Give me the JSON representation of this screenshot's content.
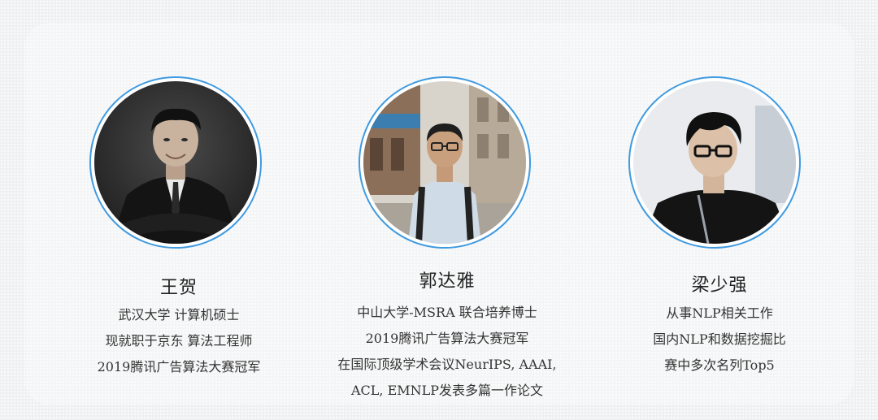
{
  "people": [
    {
      "name": "王贺",
      "lines": [
        "武汉大学 计算机硕士",
        "现就职于京东 算法工程师",
        "2019腾讯广告算法大赛冠军"
      ]
    },
    {
      "name": "郭达雅",
      "lines": [
        "中山大学-MSRA 联合培养博士",
        "2019腾讯广告算法大赛冠军",
        "在国际顶级学术会议NeurIPS, AAAI,",
        "ACL, EMNLP发表多篇一作论文"
      ]
    },
    {
      "name": "梁少强",
      "lines": [
        "从事NLP相关工作",
        "国内NLP和数据挖掘比",
        "赛中多次名列Top5"
      ]
    }
  ],
  "colors": {
    "accent_ring": "#3f9ae0",
    "background": "#eef0f1",
    "text": "#333333"
  }
}
